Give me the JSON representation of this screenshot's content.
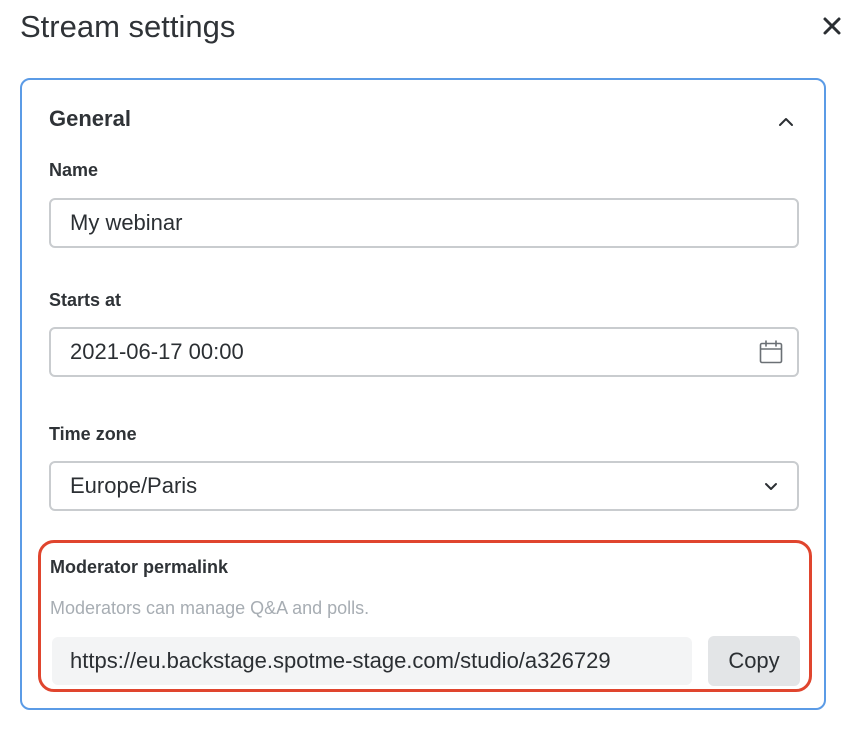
{
  "dialog": {
    "title": "Stream settings",
    "close_icon": "close-icon"
  },
  "general": {
    "section_title": "General",
    "collapse_icon": "chevron-up-icon",
    "name": {
      "label": "Name",
      "value": "My webinar"
    },
    "starts_at": {
      "label": "Starts at",
      "value": "2021-06-17 00:00",
      "icon": "calendar-icon"
    },
    "time_zone": {
      "label": "Time zone",
      "selected": "Europe/Paris",
      "icon": "chevron-down-icon"
    },
    "moderator": {
      "label": "Moderator permalink",
      "help": "Moderators can manage Q&A and polls.",
      "permalink": "https://eu.backstage.spotme-stage.com/studio/a326729",
      "copy_label": "Copy"
    }
  },
  "colors": {
    "panel_border": "#5b9be6",
    "highlight_border": "#e0452e",
    "help_text": "#a7adb3"
  }
}
